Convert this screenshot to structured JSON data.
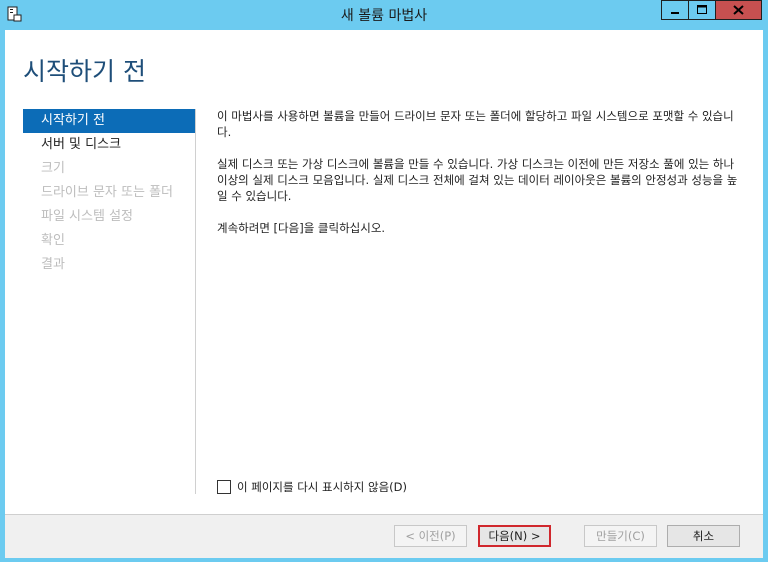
{
  "window": {
    "title": "새 볼륨 마법사",
    "app_icon": "wizard-app-icon",
    "controls": {
      "minimize": "minimize-icon",
      "maximize": "maximize-icon",
      "close": "close-icon"
    }
  },
  "page": {
    "heading": "시작하기 전"
  },
  "nav": {
    "items": [
      {
        "label": "시작하기 전",
        "state": "selected"
      },
      {
        "label": "서버 및 디스크",
        "state": "enabled"
      },
      {
        "label": "크기",
        "state": "disabled"
      },
      {
        "label": "드라이브 문자 또는 폴더",
        "state": "disabled"
      },
      {
        "label": "파일 시스템 설정",
        "state": "disabled"
      },
      {
        "label": "확인",
        "state": "disabled"
      },
      {
        "label": "결과",
        "state": "disabled"
      }
    ]
  },
  "body": {
    "para1": "이 마법사를 사용하면 볼륨을 만들어 드라이브 문자 또는 폴더에 할당하고 파일 시스템으로 포맷할 수 있습니다.",
    "para2": "실제 디스크 또는 가상 디스크에 볼륨을 만들 수 있습니다. 가상 디스크는 이전에 만든 저장소 풀에 있는 하나 이상의 실제 디스크 모음입니다. 실제 디스크 전체에 걸쳐 있는 데이터 레이아웃은 볼륨의 안정성과 성능을 높일 수 있습니다.",
    "para3": "계속하려면 [다음]을 클릭하십시오."
  },
  "checkbox": {
    "label": "이 페이지를 다시 표시하지 않음(D)",
    "checked": false
  },
  "buttons": {
    "previous": "< 이전(P)",
    "next": "다음(N) >",
    "create": "만들기(C)",
    "cancel": "취소"
  },
  "colors": {
    "titlebar": "#6ccbf0",
    "selected_nav": "#0c6cb7",
    "heading": "#1e4e79",
    "close": "#c75050",
    "default_button_border": "#d0272d"
  }
}
